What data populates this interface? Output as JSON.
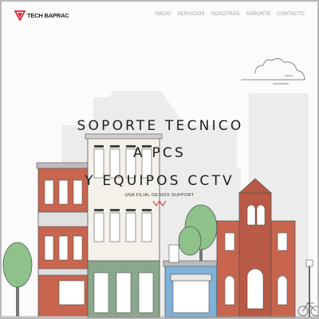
{
  "brand": {
    "name": "TECH BAPRAC",
    "icon": "triangle-logo-icon",
    "accent_color": "#d8262e"
  },
  "nav": {
    "items": [
      {
        "label": "INICIO"
      },
      {
        "label": "SERVICIOS"
      },
      {
        "label": "NOSOTROS"
      },
      {
        "label": "SOPORTE"
      },
      {
        "label": "CONTACTO"
      }
    ]
  },
  "hero": {
    "line1": "SOPORTE TECNICO",
    "line2": "A PCS",
    "line3": "Y EQUIPOS CCTV",
    "subtitle": "UNA FILIAL DE HOX SUPPORT",
    "scroll_icon": "chevron-down-icon"
  },
  "colors": {
    "brick": "#c8654f",
    "shop_blue": "#7fb1d9",
    "tree_green": "#8fc18a",
    "building_grey": "#e6e6e6",
    "background": "#fbfbfb"
  }
}
